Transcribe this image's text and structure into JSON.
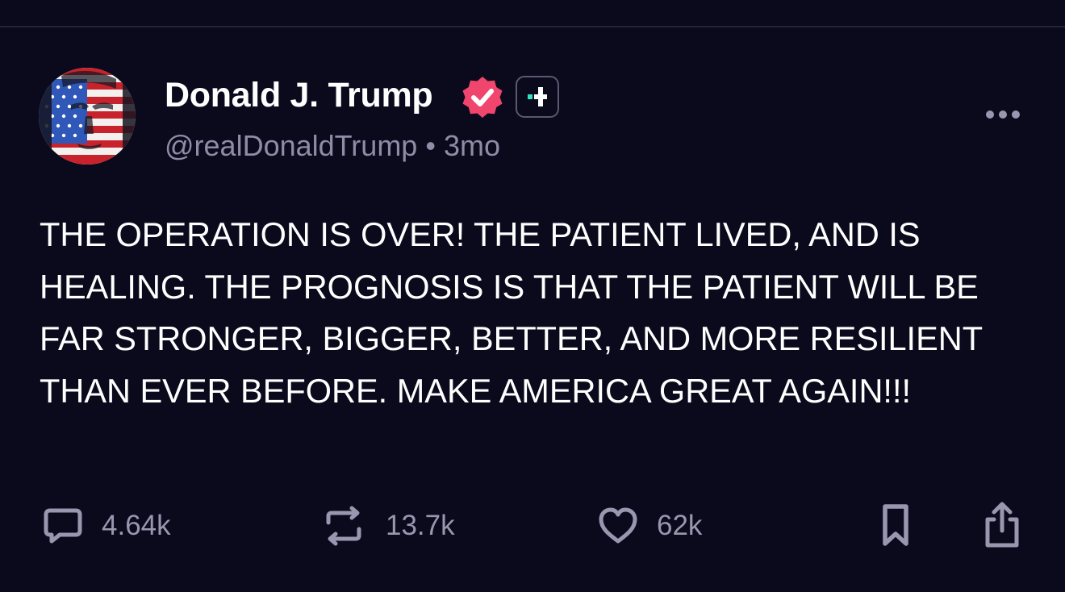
{
  "post": {
    "author": {
      "display_name": "Donald J. Trump",
      "handle": "@realDonaldTrump",
      "separator": "•",
      "timestamp": "3mo",
      "verified_icon": "verified-badge-icon",
      "verified_color": "#f0466e",
      "badge_icon": "plus-badge-icon",
      "badge_color": "#2fe3c4",
      "avatar_image": "portrait with american flag overlay"
    },
    "text": "THE OPERATION IS OVER! THE PATIENT LIVED, AND IS HEALING. THE PROGNOSIS IS THAT THE PATIENT WILL BE FAR STRONGER, BIGGER, BETTER, AND MORE RESILIENT THAN EVER BEFORE. MAKE AMERICA GREAT AGAIN!!!",
    "more_icon": "more-horizontal-icon",
    "actions": {
      "reply": {
        "icon": "reply-icon",
        "count": "4.64k"
      },
      "repost": {
        "icon": "repost-icon",
        "count": "13.7k"
      },
      "like": {
        "icon": "heart-icon",
        "count": "62k"
      },
      "bookmark": {
        "icon": "bookmark-icon"
      },
      "share": {
        "icon": "share-icon"
      }
    }
  },
  "colors": {
    "background": "#0b0a1c",
    "text_primary": "#ffffff",
    "text_secondary": "#8e8ca6",
    "icon": "#9997b0"
  }
}
